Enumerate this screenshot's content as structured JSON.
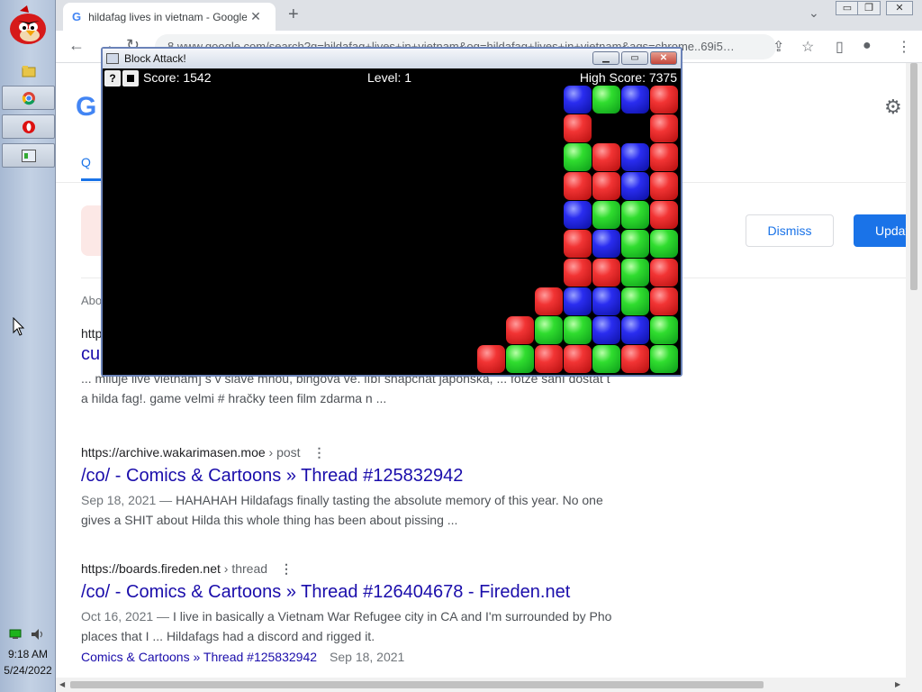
{
  "taskbar": {
    "clock_time": "9:18 AM",
    "clock_date": "5/24/2022"
  },
  "browser": {
    "tab_title": "hildafag lives in vietnam - Google",
    "tab_close": "✕",
    "new_tab": "+",
    "address": "8 www.google.com/search?q=hildafag+lives+in+vietnam&oq=hildafag+lives+in+vietnam&aqs=chrome..69i5…"
  },
  "google": {
    "logo": "G",
    "search_tab_icon": "Q",
    "notice": {
      "dismiss": "Dismiss",
      "update": "Updat"
    },
    "about": "Abo"
  },
  "results": [
    {
      "url": "http",
      "title": "cu",
      "snippet_lines": [
        "... miluje live vietnam] s v slave mnou, bingová ve. líbí snapchat japonská, ... fotze sání dostat t",
        "a hilda fag!. game velmi # hračky teen film zdarma n ..."
      ]
    },
    {
      "url": "https://archive.wakarimasen.moe",
      "crumb": "› post",
      "title": "/co/ - Comics & Cartoons » Thread #125832942",
      "date": "Sep 18, 2021 —",
      "snippet_lines": [
        "HAHAHAH Hildafags finally tasting the absolute memory of this year. No one",
        "gives a SHIT about Hilda this whole thing has been about pissing ..."
      ]
    },
    {
      "url": "https://boards.fireden.net",
      "crumb": "› thread",
      "title": "/co/ - Comics & Cartoons » Thread #126404678 - Fireden.net",
      "date": "Oct 16, 2021 —",
      "snippet_lines": [
        "I live in basically a Vietnam War Refugee city in CA and I'm surrounded by Pho",
        "places that I ... Hildafags had a discord and rigged it."
      ],
      "sublink": "Comics & Cartoons » Thread #125832942",
      "sublink_date": "Sep 18, 2021"
    }
  ],
  "game": {
    "window_title": "Block Attack!",
    "score": "Score: 1542",
    "level": "Level: 1",
    "high_score": "High Score: 7375",
    "help_btn": "?",
    "grid": {
      "rows": [
        "....bgbr",
        "....r..r",
        "....grbr",
        "....rrbr",
        "....bggr",
        "....rbgg",
        "....rrgr",
        "...rbbgr",
        "..rggbbg",
        ".rgrrgrg"
      ],
      "colors": {
        "r": "red",
        "g": "green",
        "b": "blue"
      }
    }
  }
}
